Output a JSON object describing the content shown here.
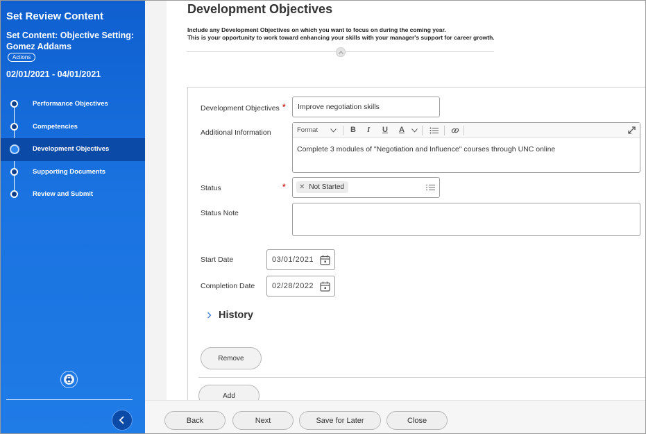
{
  "sidebar": {
    "title": "Set Review Content",
    "subtitle": "Set Content: Objective Setting: Gomez Addams",
    "actions_label": "Actions",
    "date_range": "02/01/2021 - 04/01/2021",
    "steps": [
      {
        "label": "Performance Objectives",
        "active": false
      },
      {
        "label": "Competencies",
        "active": false
      },
      {
        "label": "Development Objectives",
        "active": true
      },
      {
        "label": "Supporting Documents",
        "active": false
      },
      {
        "label": "Review and Submit",
        "active": false
      }
    ],
    "print_icon": "printer-icon",
    "collapse_icon": "chevron-left-icon"
  },
  "main": {
    "title": "Development Objectives",
    "description_line1": "Include any Development Objectives on which you want to focus on during the coming year.",
    "description_line2": "This is your opportunity to work toward enhancing your skills with your manager's support for career growth.",
    "form": {
      "dev_obj_label": "Development Objectives",
      "dev_obj_value": "Improve negotiation skills",
      "additional_info_label": "Additional Information",
      "additional_info_value": "Complete 3 modules of \"Negotiation and Influence\" courses through UNC online",
      "toolbar": {
        "format_label": "Format",
        "bold": "B",
        "italic": "I",
        "underline": "U",
        "font_color": "A"
      },
      "status_label": "Status",
      "status_value": "Not Started",
      "status_note_label": "Status Note",
      "status_note_value": "",
      "start_date_label": "Start Date",
      "start_date_value": "03/01/2021",
      "completion_date_label": "Completion Date",
      "completion_date_value": "02/28/2022",
      "history_label": "History",
      "remove_label": "Remove",
      "add_label": "Add"
    }
  },
  "footer": {
    "back_label": "Back",
    "next_label": "Next",
    "save_label": "Save for Later",
    "close_label": "Close"
  },
  "colors": {
    "sidebar_blue": "#1a73e0",
    "sidebar_active": "#0b4aa6",
    "required_red": "#d32f2f"
  }
}
